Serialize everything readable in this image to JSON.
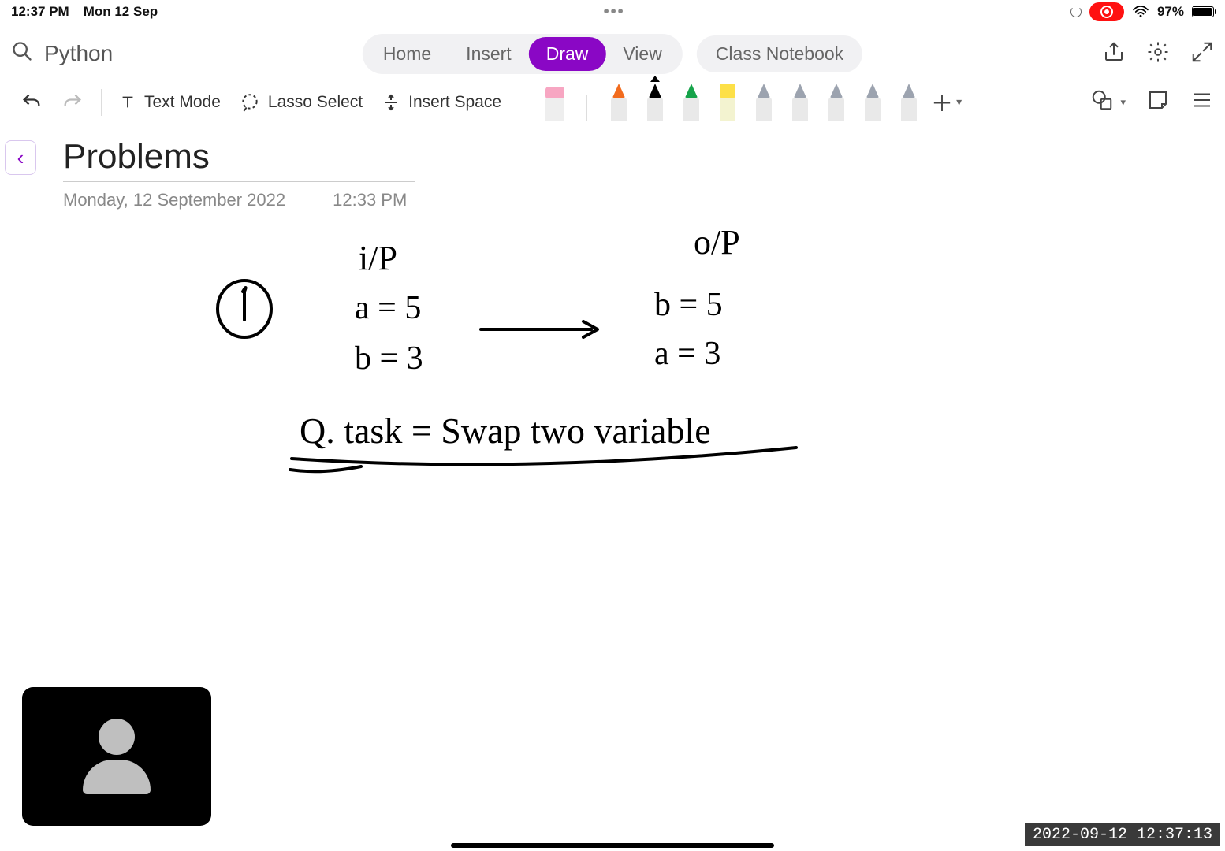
{
  "status": {
    "time": "12:37 PM",
    "date": "Mon 12 Sep",
    "battery_pct": "97%"
  },
  "notebook_name": "Python",
  "tabs": {
    "home": "Home",
    "insert": "Insert",
    "draw": "Draw",
    "view": "View",
    "class_notebook": "Class Notebook"
  },
  "drawbar": {
    "text_mode": "Text Mode",
    "lasso": "Lasso Select",
    "insert_space": "Insert Space"
  },
  "pens": [
    {
      "name": "eraser",
      "color": "#f7a6c2",
      "kind": "eraser"
    },
    {
      "name": "orange-marker",
      "color": "#f26b1d",
      "kind": "marker"
    },
    {
      "name": "black-marker",
      "color": "#000000",
      "kind": "marker",
      "active": true
    },
    {
      "name": "green-marker",
      "color": "#16a34a",
      "kind": "marker"
    },
    {
      "name": "yellow-highlighter",
      "color": "#fde047",
      "kind": "highlighter"
    },
    {
      "name": "gray-marker-1",
      "color": "#9ca3af",
      "kind": "marker"
    },
    {
      "name": "gray-marker-2",
      "color": "#9ca3af",
      "kind": "marker"
    },
    {
      "name": "gray-marker-3",
      "color": "#9ca3af",
      "kind": "marker"
    },
    {
      "name": "gray-marker-4",
      "color": "#9ca3af",
      "kind": "marker"
    },
    {
      "name": "gray-marker-5",
      "color": "#9ca3af",
      "kind": "marker"
    }
  ],
  "page": {
    "title": "Problems",
    "date": "Monday, 12 September 2022",
    "time": "12:33 PM"
  },
  "handwriting": {
    "bullet": "1",
    "ip_label": "i/P",
    "op_label": "o/P",
    "input_lines": [
      "a = 5",
      "b = 3"
    ],
    "output_lines": [
      "b = 5",
      "a = 3"
    ],
    "question": "Q.  task = Swap two variable"
  },
  "stamp": "2022-09-12 12:37:13"
}
